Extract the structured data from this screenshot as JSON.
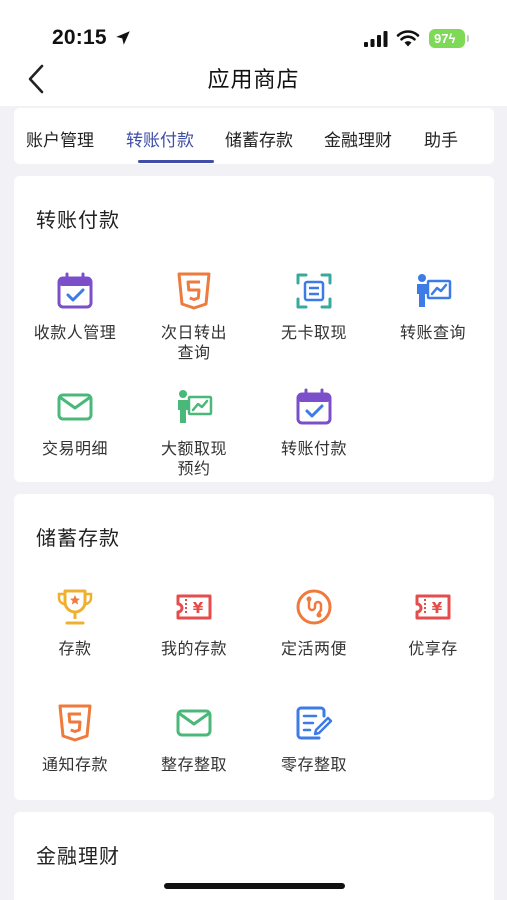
{
  "status_bar": {
    "time": "20:15",
    "battery": "97"
  },
  "nav": {
    "title": "应用商店"
  },
  "tabs": [
    {
      "label": "账户管理",
      "active": false
    },
    {
      "label": "转账付款",
      "active": true
    },
    {
      "label": "储蓄存款",
      "active": false
    },
    {
      "label": "金融理财",
      "active": false
    },
    {
      "label": "助手",
      "active": false
    }
  ],
  "sections": {
    "transfer": {
      "title": "转账付款",
      "items": [
        {
          "label": "收款人管理",
          "icon": "calendar-check-icon"
        },
        {
          "label": "次日转出\n查询",
          "icon": "html5-icon"
        },
        {
          "label": "无卡取现",
          "icon": "scan-icon"
        },
        {
          "label": "转账查询",
          "icon": "presenter-chart-icon"
        },
        {
          "label": "交易明细",
          "icon": "envelope-icon"
        },
        {
          "label": "大额取现\n预约",
          "icon": "presenter-chart-icon"
        },
        {
          "label": "转账付款",
          "icon": "calendar-check-icon"
        }
      ]
    },
    "savings": {
      "title": "储蓄存款",
      "items": [
        {
          "label": "存款",
          "icon": "trophy-icon"
        },
        {
          "label": "我的存款",
          "icon": "yen-ticket-icon"
        },
        {
          "label": "定活两便",
          "icon": "route-icon"
        },
        {
          "label": "优享存",
          "icon": "yen-ticket-icon"
        },
        {
          "label": "通知存款",
          "icon": "html5-icon"
        },
        {
          "label": "整存整取",
          "icon": "envelope-icon"
        },
        {
          "label": "零存整取",
          "icon": "edit-document-icon"
        }
      ]
    },
    "wealth": {
      "title": "金融理财"
    }
  },
  "colors": {
    "accent": "#3f4fa6",
    "purple": "#7b4fc9",
    "orange": "#ef7a3d",
    "teal": "#3aa89c",
    "blue": "#3d7be6",
    "green": "#49b878",
    "red": "#e54c4c",
    "yellow": "#f0b02f"
  }
}
